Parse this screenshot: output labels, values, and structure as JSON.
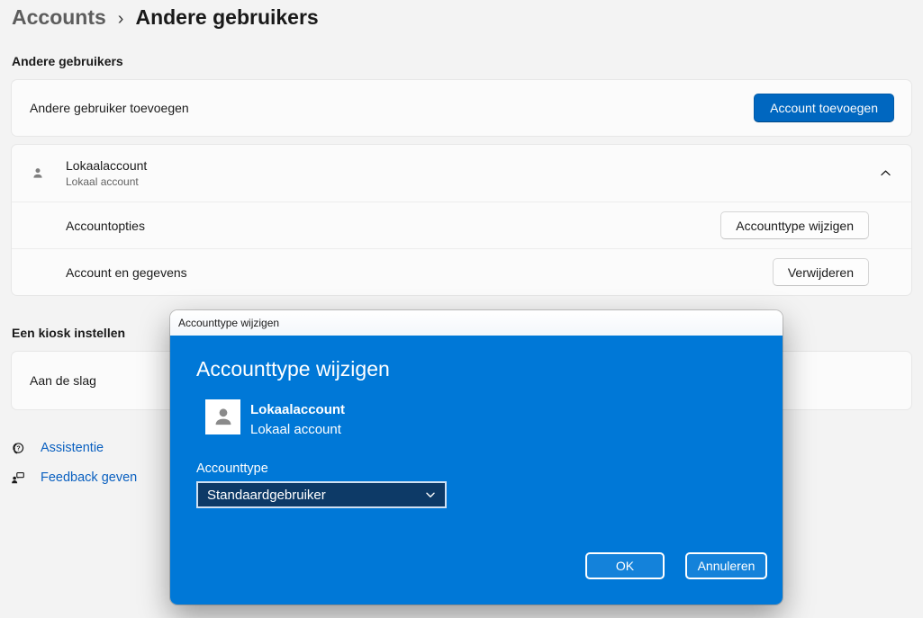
{
  "breadcrumb": {
    "parent": "Accounts",
    "separator": "›",
    "current": "Andere gebruikers"
  },
  "other_users": {
    "section_header": "Andere gebruikers",
    "add_row": {
      "label": "Andere gebruiker toevoegen",
      "button_label": "Account toevoegen"
    },
    "account": {
      "name": "Lokaalaccount",
      "subtitle": "Lokaal account",
      "rows": [
        {
          "label": "Accountopties",
          "button_label": "Accounttype wijzigen"
        },
        {
          "label": "Account en gegevens",
          "button_label": "Verwijderen"
        }
      ]
    }
  },
  "kiosk": {
    "section_header": "Een kiosk instellen",
    "row_label": "Aan de slag"
  },
  "footer": {
    "links": [
      {
        "label": "Assistentie"
      },
      {
        "label": "Feedback geven"
      }
    ]
  },
  "dialog": {
    "titlebar_title": "Accounttype wijzigen",
    "heading": "Accounttype wijzigen",
    "account_name": "Lokaalaccount",
    "account_subtitle": "Lokaal account",
    "field_label": "Accounttype",
    "dropdown_value": "Standaardgebruiker",
    "ok_label": "OK",
    "cancel_label": "Annuleren"
  },
  "colors": {
    "page_background": "#f3f3f3",
    "card_background": "#fbfbfb",
    "accent_button": "#0067c0",
    "dialog_blue": "#0078d7",
    "dropdown_background": "#0d3a67",
    "link_blue": "#0a60c0"
  }
}
